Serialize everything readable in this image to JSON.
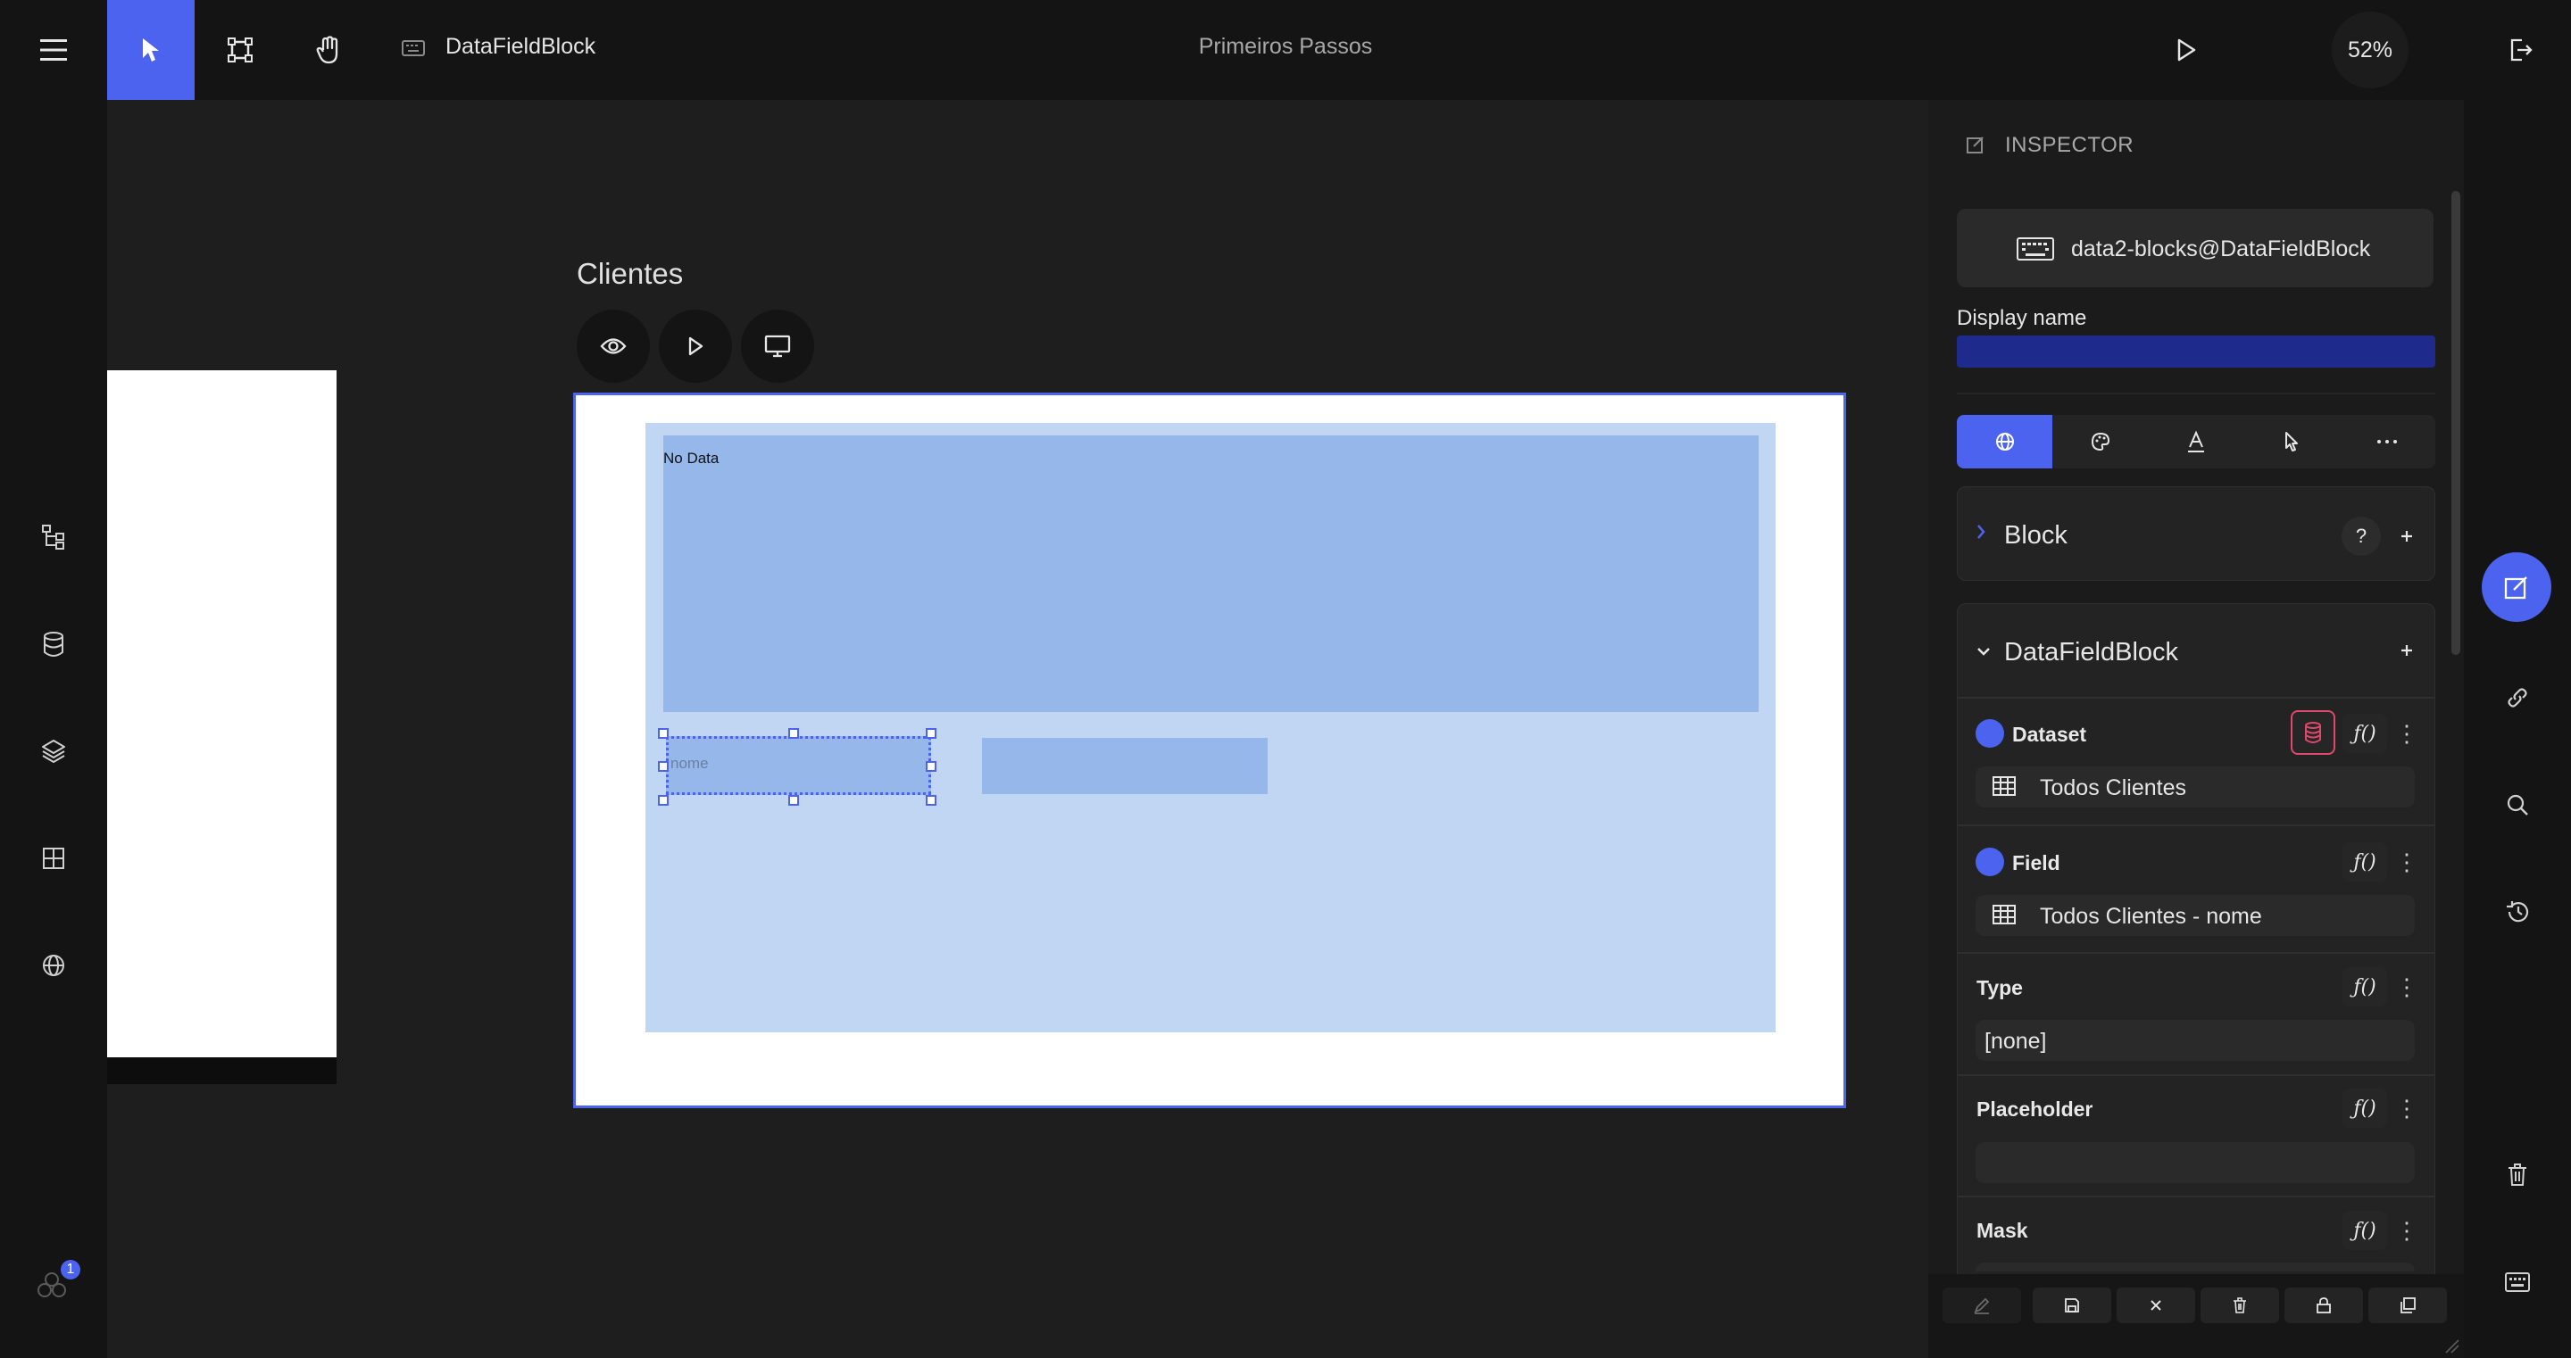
{
  "topbar": {
    "block_label": "DataFieldBlock",
    "project_title": "Primeiros Passos",
    "zoom": "52%"
  },
  "canvas": {
    "page_title": "Clientes",
    "no_data_label": "No Data",
    "field_placeholder": "nome"
  },
  "inspector": {
    "title": "INSPECTOR",
    "component_id": "data2-blocks@DataFieldBlock",
    "display_name_label": "Display name",
    "display_name_value": "",
    "block_section": {
      "title": "Block",
      "help": "?"
    },
    "datafield_section": {
      "title": "DataFieldBlock"
    },
    "dataset": {
      "label": "Dataset",
      "value": "Todos Clientes"
    },
    "field": {
      "label": "Field",
      "value": "Todos Clientes - nome"
    },
    "type": {
      "label": "Type",
      "value": "[none]"
    },
    "placeholder": {
      "label": "Placeholder",
      "value": ""
    },
    "mask": {
      "label": "Mask"
    },
    "fx_label": "ƒ()"
  },
  "notifications": {
    "badge": "1"
  },
  "colors": {
    "accent": "#4b63ee",
    "block_bg": "#c1d6f3",
    "inner_bg": "#96b7e9",
    "display_name_bar": "#1e2a8c"
  }
}
